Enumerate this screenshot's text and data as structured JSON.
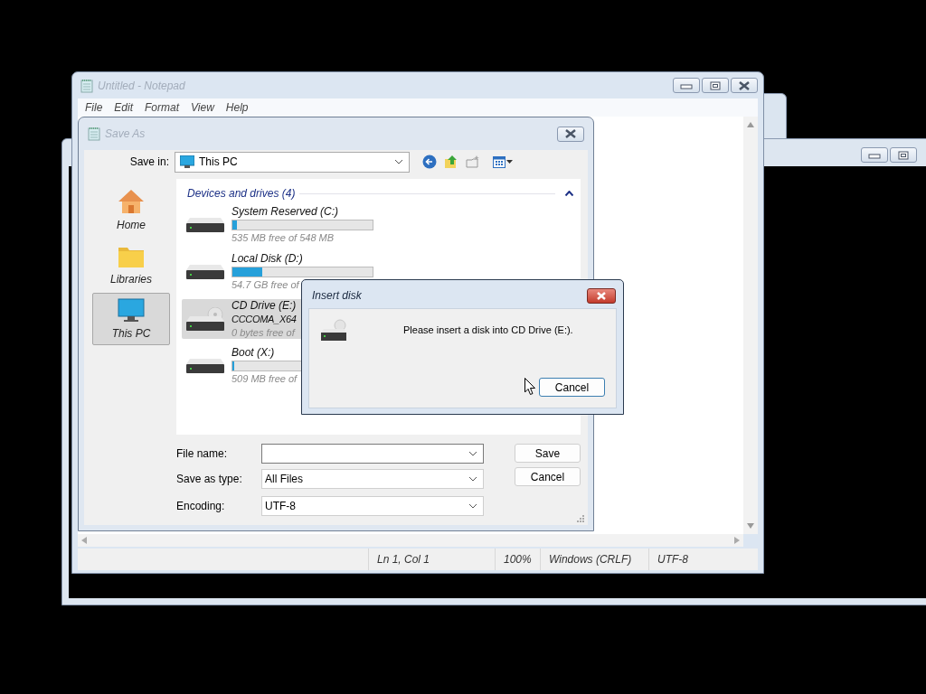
{
  "notepad": {
    "title": "Untitled - Notepad",
    "menu": [
      "File",
      "Edit",
      "Format",
      "View",
      "Help"
    ],
    "status_bar": [
      "Ln 1, Col 1",
      "100%",
      "Windows (CRLF)",
      "UTF-8"
    ]
  },
  "save_as": {
    "title": "Save As",
    "save_in": {
      "label": "Save in:",
      "value": "This PC"
    },
    "places": [
      {
        "label": "Home",
        "kind": "home",
        "selected": false
      },
      {
        "label": "Libraries",
        "kind": "libraries",
        "selected": false
      },
      {
        "label": "This PC",
        "kind": "pc",
        "selected": true
      }
    ],
    "group": {
      "header": "Devices and drives (4)",
      "expanded": true
    },
    "drives": [
      {
        "name": "System Reserved (C:)",
        "kind": "disk",
        "level": 0.03,
        "free": "535 MB free of 548 MB",
        "selected": false
      },
      {
        "name": "Local Disk (D:)",
        "kind": "disk",
        "level": 0.21,
        "free": "54.7 GB free of",
        "selected": false
      },
      {
        "name": "CD Drive (E:)",
        "kind": "optical",
        "volume_label": "CCCOMA_X64",
        "free": "0 bytes free of",
        "selected": true
      },
      {
        "name": "Boot (X:)",
        "kind": "disk",
        "level": 0.01,
        "free": "509 MB free of",
        "selected": false
      }
    ],
    "fields": [
      {
        "label": "File name:"
      },
      {
        "label": "Save as type:",
        "value": "All Files"
      },
      {
        "label": "Encoding:",
        "value": "UTF-8"
      }
    ],
    "buttons": [
      "Save",
      "Cancel"
    ]
  },
  "insert_disk": {
    "title": "Insert disk",
    "message": "Please insert a disk into CD Drive (E:).",
    "button": "Cancel"
  }
}
